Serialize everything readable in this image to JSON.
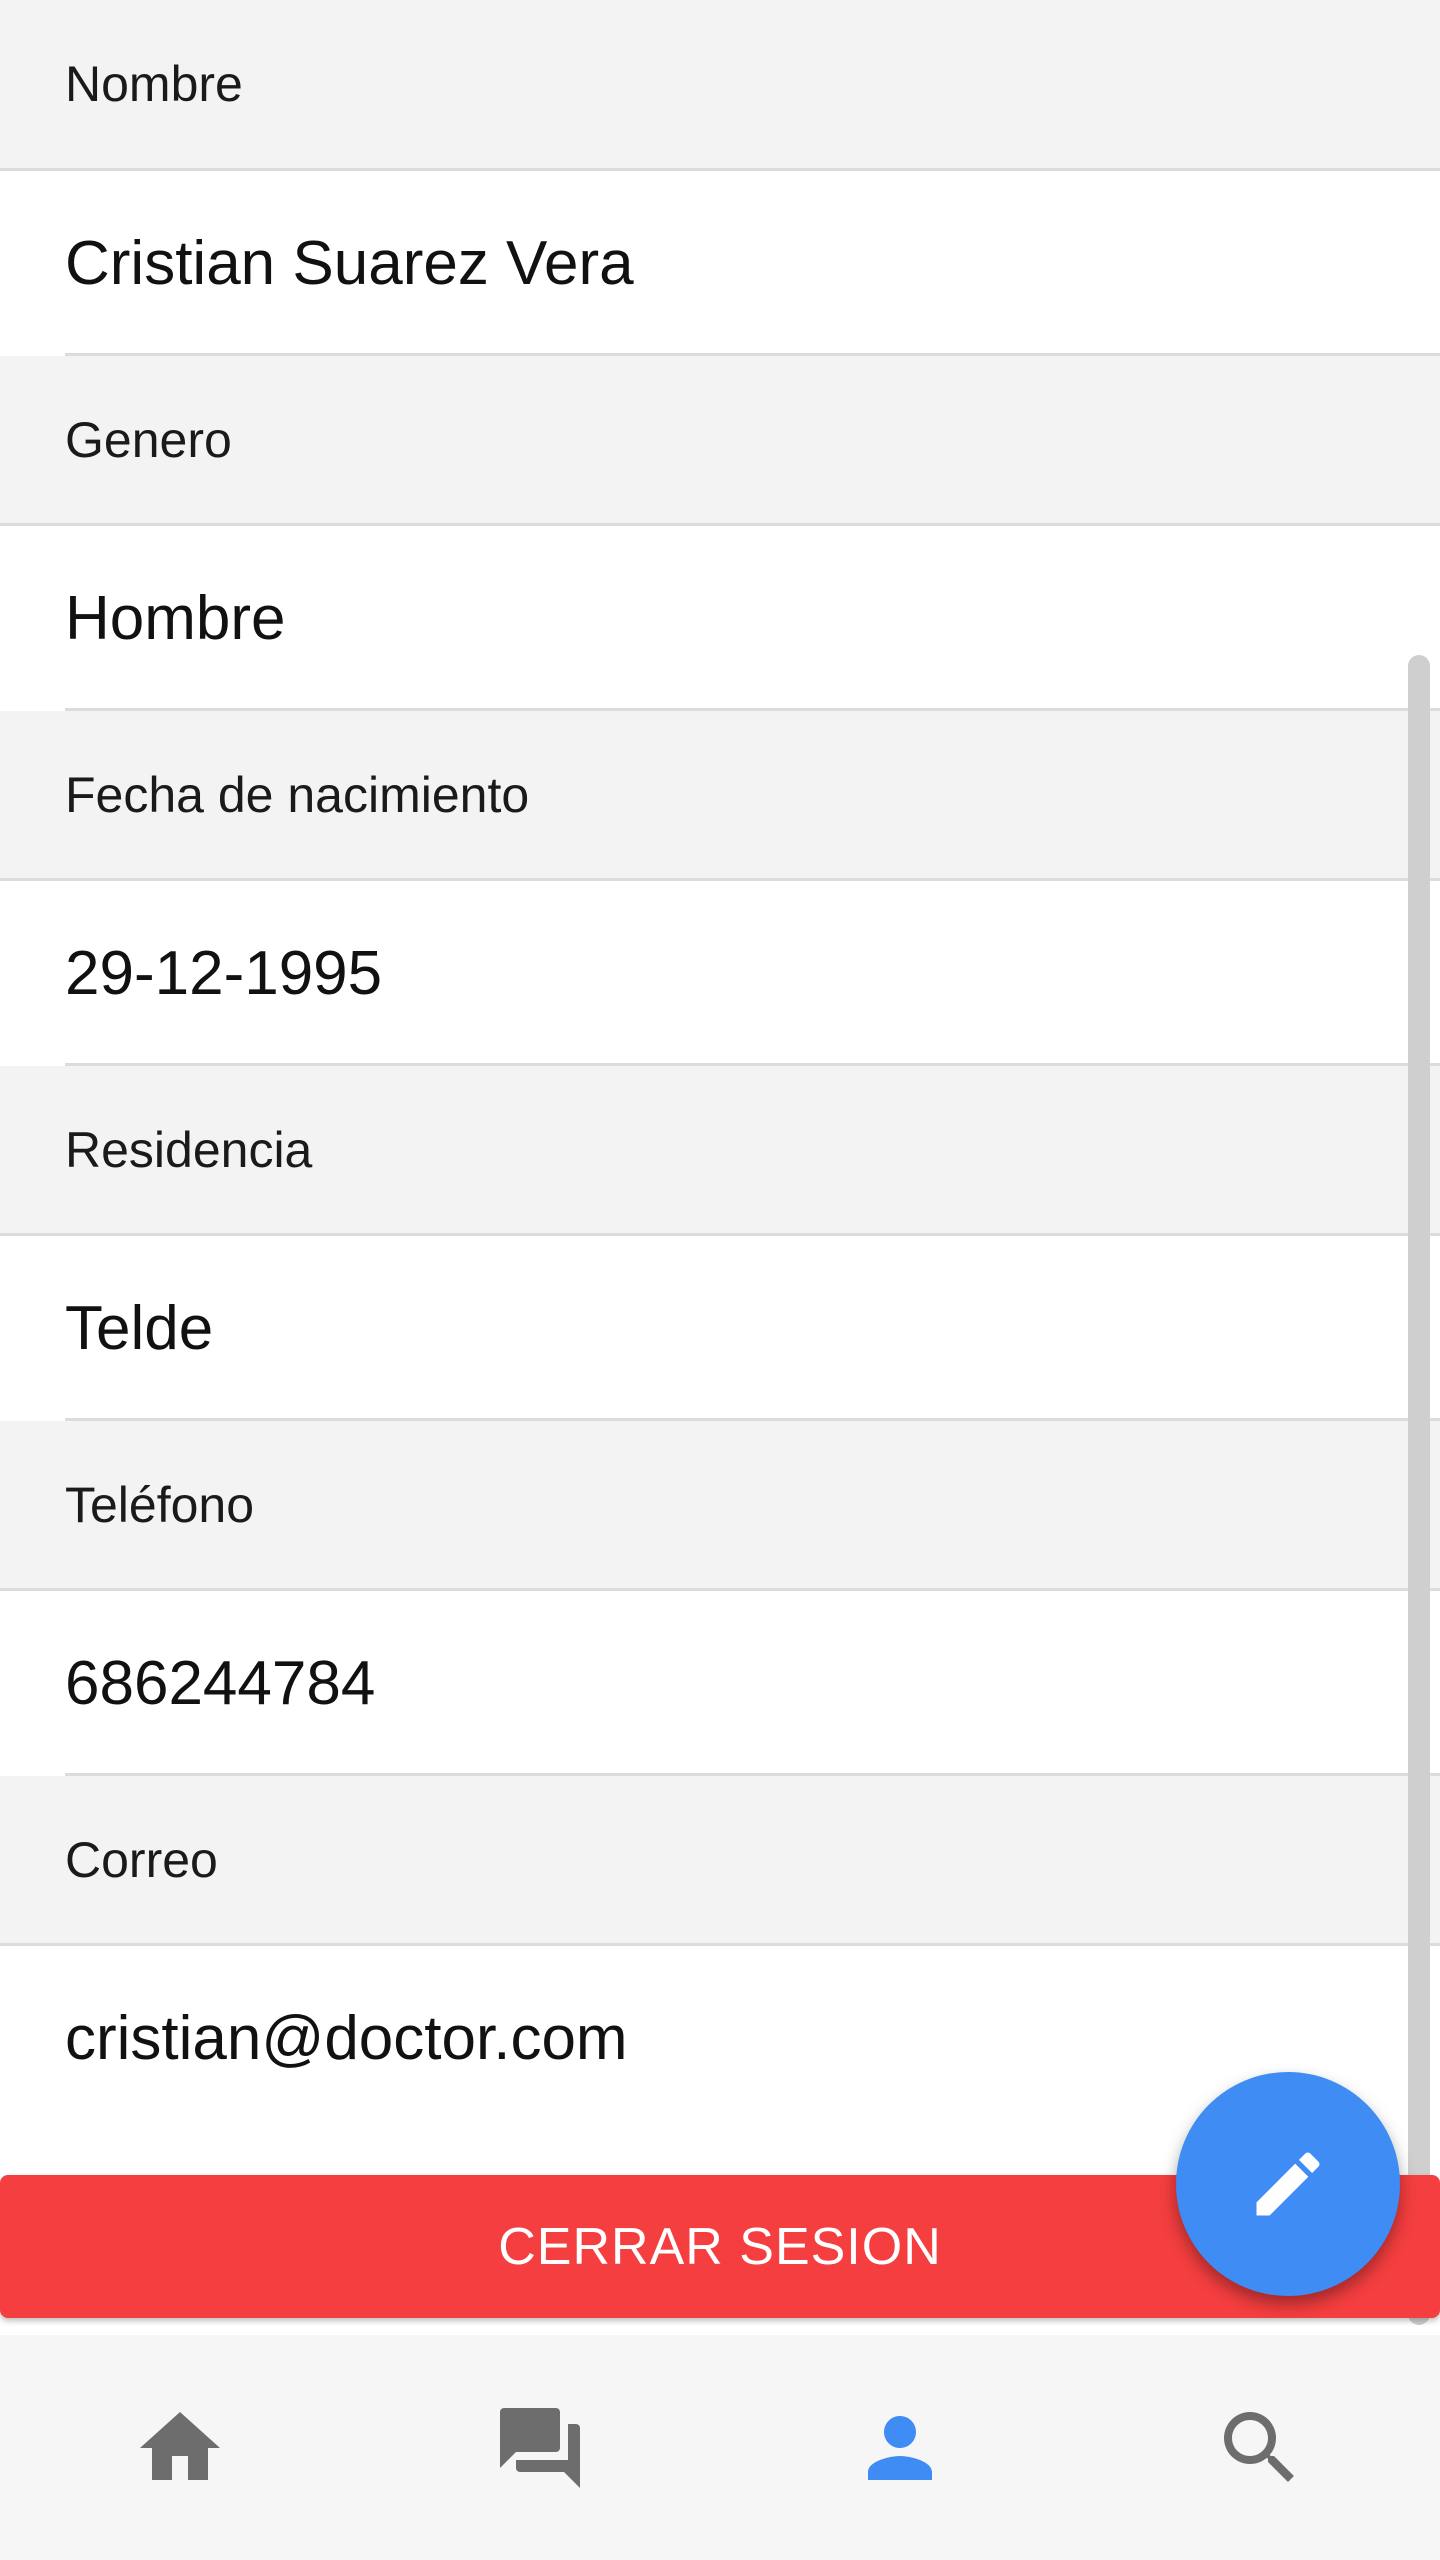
{
  "profile": {
    "fields": [
      {
        "label": "Nombre",
        "value": "Cristian Suarez Vera"
      },
      {
        "label": "Genero",
        "value": "Hombre"
      },
      {
        "label": "Fecha de nacimiento",
        "value": "29-12-1995"
      },
      {
        "label": "Residencia",
        "value": "Telde"
      },
      {
        "label": "Teléfono",
        "value": "686244784"
      },
      {
        "label": "Correo",
        "value": "cristian@doctor.com"
      }
    ]
  },
  "actions": {
    "logout_label": "CERRAR SESION",
    "edit_icon": "pencil-icon"
  },
  "bottom_nav": {
    "items": [
      {
        "icon": "home-icon",
        "active": false
      },
      {
        "icon": "chat-icon",
        "active": false
      },
      {
        "icon": "person-icon",
        "active": true
      },
      {
        "icon": "search-icon",
        "active": false
      }
    ]
  },
  "colors": {
    "accent": "#3f8cf4",
    "danger": "#f43e3f",
    "nav_inactive": "#6d6d6d"
  }
}
